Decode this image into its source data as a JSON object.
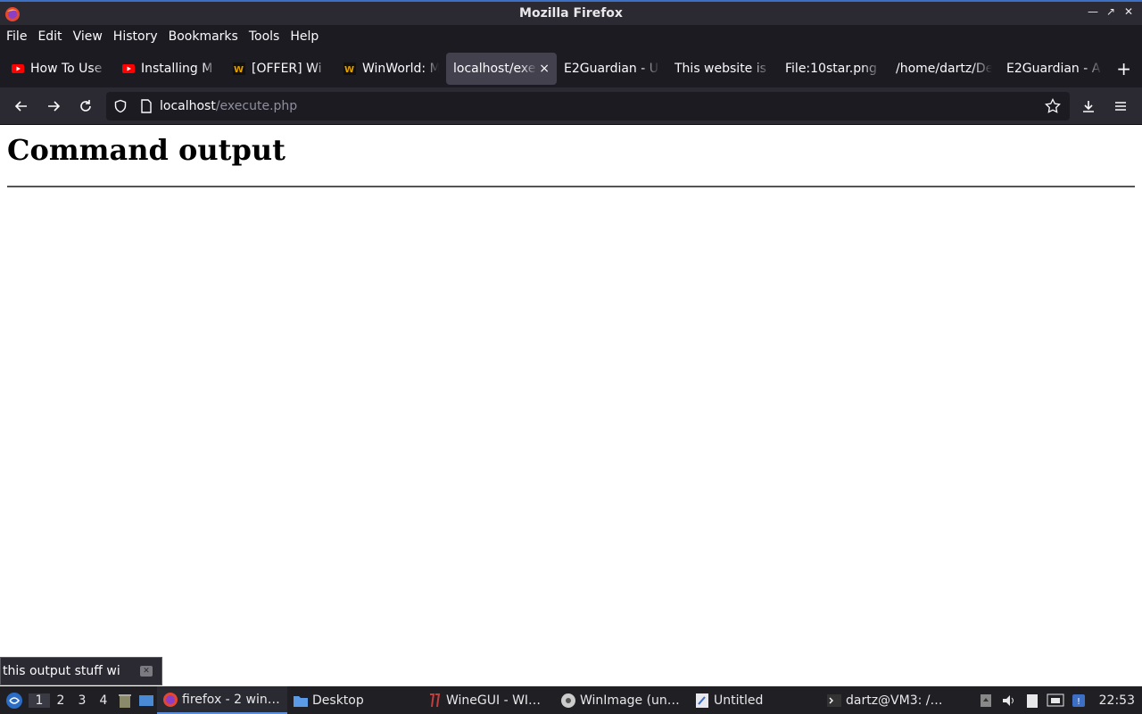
{
  "window": {
    "title": "Mozilla Firefox"
  },
  "menu": [
    "File",
    "Edit",
    "View",
    "History",
    "Bookmarks",
    "Tools",
    "Help"
  ],
  "tabs": [
    {
      "label": "How To Use",
      "icon": "youtube-icon"
    },
    {
      "label": "Installing M",
      "icon": "youtube-icon"
    },
    {
      "label": "[OFFER] Wi",
      "icon": "winworld-icon"
    },
    {
      "label": "WinWorld: M",
      "icon": "winworld-icon"
    },
    {
      "label": "localhost/exe",
      "icon": "",
      "active": true,
      "close": "×"
    },
    {
      "label": "E2Guardian - U",
      "icon": ""
    },
    {
      "label": "This website is",
      "icon": ""
    },
    {
      "label": "File:10star.png",
      "icon": ""
    },
    {
      "label": "/home/dartz/De",
      "icon": ""
    },
    {
      "label": "E2Guardian - A",
      "icon": ""
    }
  ],
  "newtab": "+",
  "urlbar": {
    "host": "localhost",
    "path": "/execute.php"
  },
  "page": {
    "heading": "Command output"
  },
  "find": {
    "text": "this output stuff wi"
  },
  "taskbar": {
    "workspaces": [
      "1",
      "2",
      "3",
      "4"
    ],
    "tasks": [
      {
        "label": "firefox - 2 win…",
        "icon": "firefox-icon",
        "active": true
      },
      {
        "label": "Desktop",
        "icon": "folder-icon"
      },
      {
        "label": "WineGUI - WI…",
        "icon": "wine-icon"
      },
      {
        "label": "WinImage (un…",
        "icon": "winimage-icon"
      },
      {
        "label": "Untitled",
        "icon": "text-editor-icon"
      },
      {
        "label": "dartz@VM3: /…",
        "icon": "terminal-icon"
      }
    ],
    "clock": "22:53"
  },
  "colors": {
    "accent": "#3d6fc4",
    "toolbar": "#2b2a33",
    "chrome": "#1c1b22"
  }
}
